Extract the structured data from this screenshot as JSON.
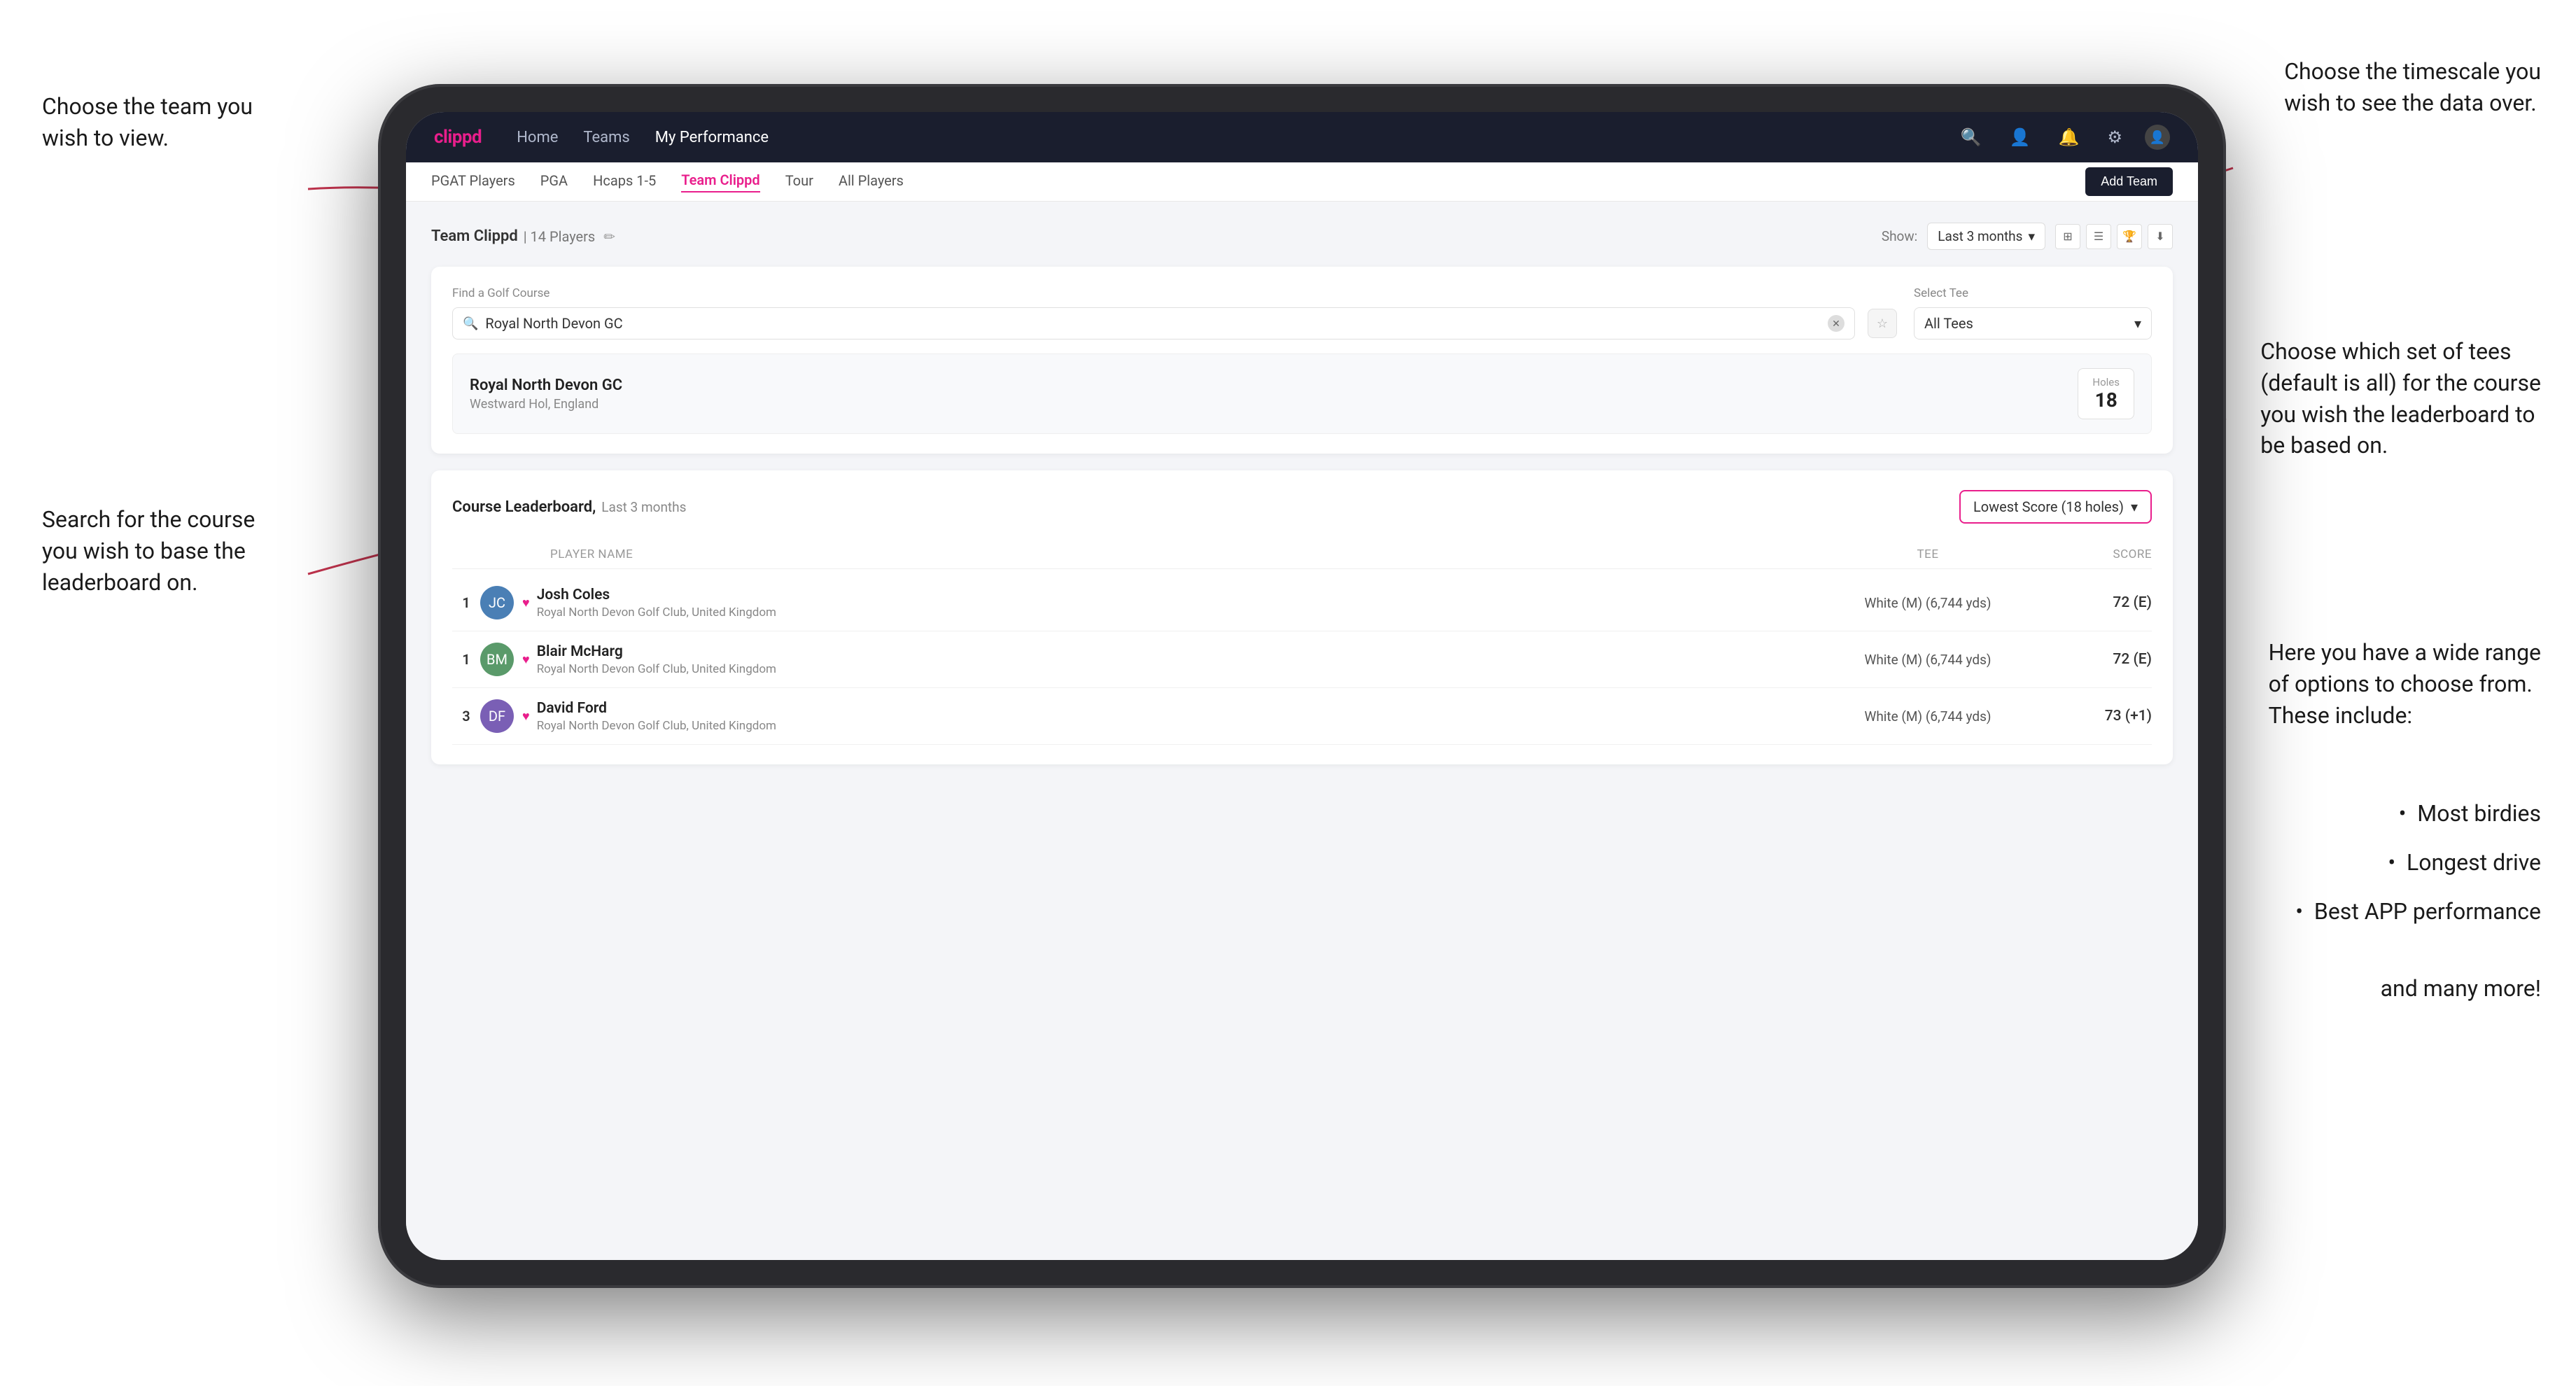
{
  "annotations": {
    "top_left_title": "Choose the team you\nwish to view.",
    "top_right_title": "Choose the timescale you\nwish to see the data over.",
    "mid_right_title": "Choose which set of tees\n(default is all) for the course\nyou wish the leaderboard to\nbe based on.",
    "bottom_left_title": "Search for the course\nyou wish to base the\nleaderboard on.",
    "bottom_right_title": "Here you have a wide range\nof options to choose from.\nThese include:",
    "bullet1": "Most birdies",
    "bullet2": "Longest drive",
    "bullet3": "Best APP performance",
    "and_more": "and many more!"
  },
  "nav": {
    "logo": "clippd",
    "links": [
      "Home",
      "Teams",
      "My Performance"
    ],
    "active_link": "My Performance"
  },
  "secondary_nav": {
    "items": [
      "PGAT Players",
      "PGA",
      "Hcaps 1-5",
      "Team Clippd",
      "Tour",
      "All Players"
    ],
    "active_item": "Team Clippd",
    "add_team_label": "Add Team"
  },
  "team_header": {
    "title": "Team Clippd",
    "count": "| 14 Players",
    "show_label": "Show:",
    "show_value": "Last 3 months"
  },
  "search": {
    "find_label": "Find a Golf Course",
    "placeholder": "Royal North Devon GC",
    "select_tee_label": "Select Tee",
    "tee_value": "All Tees"
  },
  "course_result": {
    "name": "Royal North Devon GC",
    "location": "Westward Hol, England",
    "holes_label": "Holes",
    "holes_value": "18"
  },
  "leaderboard": {
    "title": "Course Leaderboard,",
    "subtitle": "Last 3 months",
    "score_type": "Lowest Score (18 holes)",
    "columns": {
      "player": "PLAYER NAME",
      "tee": "TEE",
      "score": "SCORE"
    },
    "players": [
      {
        "rank": "1",
        "name": "Josh Coles",
        "club": "Royal North Devon Golf Club, United Kingdom",
        "tee": "White (M) (6,744 yds)",
        "score": "72 (E)",
        "av_color": "av-blue"
      },
      {
        "rank": "1",
        "name": "Blair McHarg",
        "club": "Royal North Devon Golf Club, United Kingdom",
        "tee": "White (M) (6,744 yds)",
        "score": "72 (E)",
        "av_color": "av-green"
      },
      {
        "rank": "3",
        "name": "David Ford",
        "club": "Royal North Devon Golf Club, United Kingdom",
        "tee": "White (M) (6,744 yds)",
        "score": "73 (+1)",
        "av_color": "av-purple"
      }
    ]
  },
  "options_list": {
    "items": [
      "Most birdies",
      "Longest drive",
      "Best APP performance"
    ]
  }
}
